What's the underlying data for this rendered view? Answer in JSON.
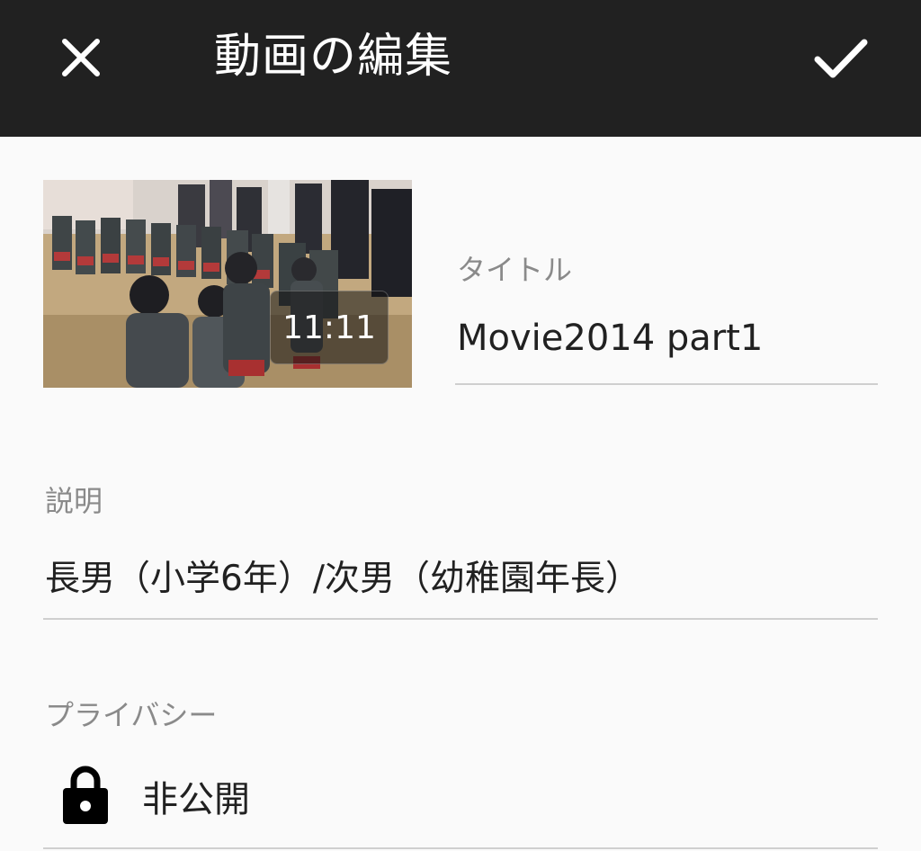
{
  "toolbar": {
    "title": "動画の編集",
    "close_icon": "close-icon",
    "confirm_icon": "check-icon",
    "background": "#212121"
  },
  "video": {
    "duration": "11:11"
  },
  "fields": {
    "title": {
      "label": "タイトル",
      "value": "Movie2014  part1"
    },
    "description": {
      "label": "説明",
      "value": "長男（小学6年）/次男（幼稚園年長）"
    },
    "privacy": {
      "label": "プライバシー",
      "value": "非公開",
      "icon": "lock-icon"
    }
  }
}
